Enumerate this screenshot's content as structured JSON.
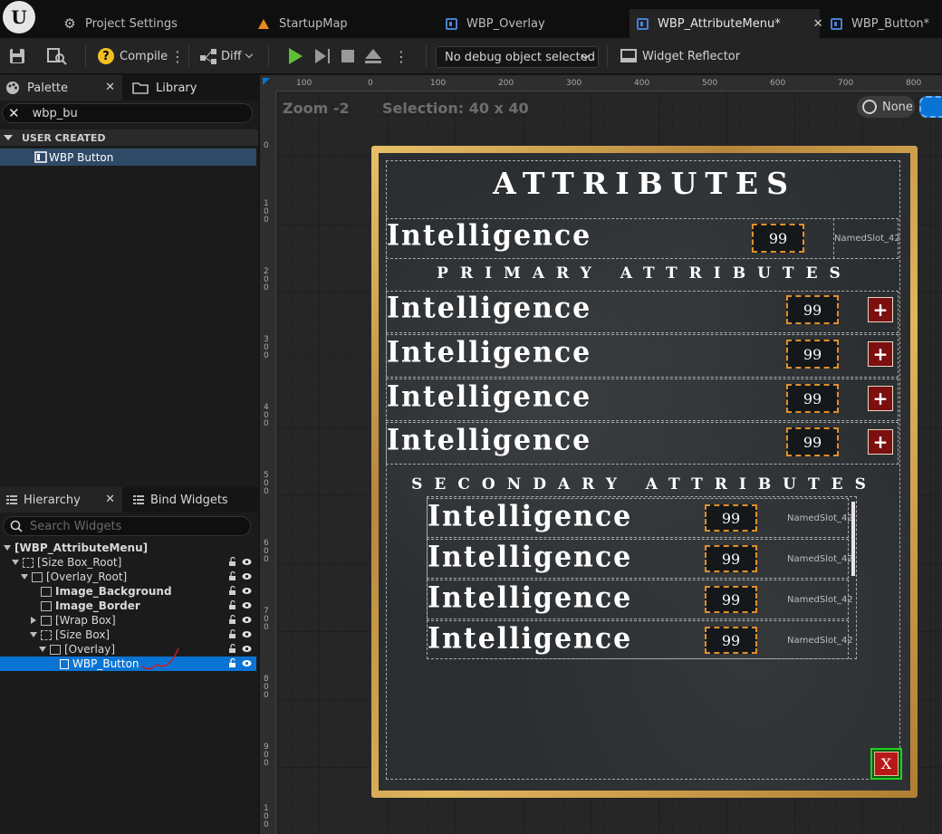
{
  "tabs": [
    {
      "label": "Project Settings"
    },
    {
      "label": "StartupMap"
    },
    {
      "label": "WBP_Overlay"
    },
    {
      "label": "WBP_AttributeMenu*"
    },
    {
      "label": "WBP_Button*"
    }
  ],
  "toolbar": {
    "compile_label": "Compile",
    "diff_label": "Diff",
    "debug_selected": "No debug object selected",
    "reflector_label": "Widget Reflector"
  },
  "palette": {
    "tab_label": "Palette",
    "library_label": "Library",
    "search_value": "wbp_bu",
    "category": "USER CREATED",
    "items": [
      "WBP Button"
    ]
  },
  "hierarchy": {
    "tab_label": "Hierarchy",
    "bind_label": "Bind Widgets",
    "search_placeholder": "Search Widgets",
    "nodes": [
      "[WBP_AttributeMenu]",
      "[Size Box_Root]",
      "[Overlay_Root]",
      "Image_Background",
      "Image_Border",
      "[Wrap Box]",
      "[Size Box]",
      "[Overlay]",
      "WBP_Button"
    ]
  },
  "designer": {
    "zoom": "Zoom -2",
    "selection": "Selection: 40 x 40",
    "dpi_label": "None",
    "ruler_top": [
      "100",
      "0",
      "100",
      "200",
      "300",
      "400",
      "500",
      "600",
      "700",
      "800"
    ],
    "ruler_left": [
      "0",
      "1\n0\n0",
      "2\n0\n0",
      "3\n0\n0",
      "4\n0\n0",
      "5\n0\n0",
      "6\n0\n0",
      "7\n0\n0",
      "8\n0\n0",
      "9\n0\n0",
      "1\n0\n0"
    ]
  },
  "menu": {
    "title": "ATTRIBUTES",
    "primary_header": "PRIMARY ATTRIBUTES",
    "secondary_header": "SECONDARY ATTRIBUTES",
    "top_row": {
      "label": "Intelligence",
      "value": "99",
      "slot": "NamedSlot_42"
    },
    "primary_rows": [
      {
        "label": "Intelligence",
        "value": "99"
      },
      {
        "label": "Intelligence",
        "value": "99"
      },
      {
        "label": "Intelligence",
        "value": "99"
      },
      {
        "label": "Intelligence",
        "value": "99"
      }
    ],
    "secondary_rows": [
      {
        "label": "Intelligence",
        "value": "99",
        "slot": "NamedSlot_42"
      },
      {
        "label": "Intelligence",
        "value": "99",
        "slot": "NamedSlot_42"
      },
      {
        "label": "Intelligence",
        "value": "99",
        "slot": "NamedSlot_42"
      },
      {
        "label": "Intelligence",
        "value": "99",
        "slot": "NamedSlot_42"
      }
    ],
    "plus_symbol": "+",
    "close_symbol": "X"
  },
  "colors": {
    "selection_blue": "#0a74d4",
    "frame_gold": "#c89a46",
    "value_border": "#e0902a",
    "plus_red": "#7c0f0f",
    "close_green": "#1fd11f"
  }
}
